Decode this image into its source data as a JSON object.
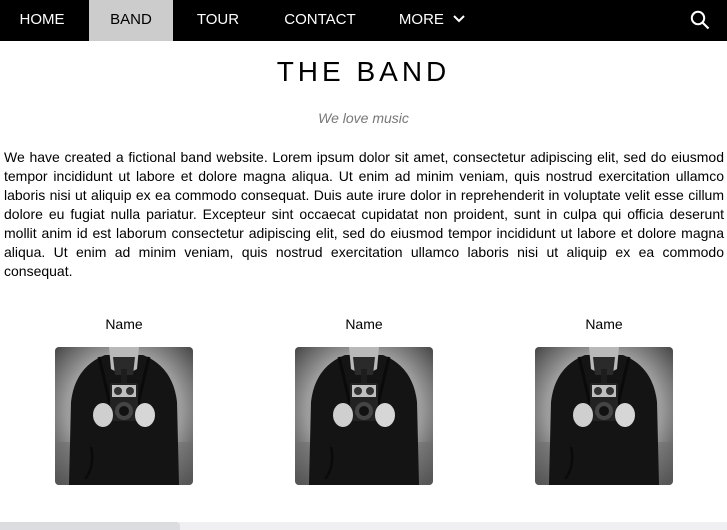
{
  "nav": {
    "items": [
      {
        "label": "HOME"
      },
      {
        "label": "BAND"
      },
      {
        "label": "TOUR"
      },
      {
        "label": "CONTACT"
      },
      {
        "label": "MORE"
      }
    ],
    "active": "BAND",
    "search_icon": "search-icon"
  },
  "band": {
    "title": "THE BAND",
    "tagline": "We love music",
    "description": "We have created a fictional band website. Lorem ipsum dolor sit amet, consectetur adipiscing elit, sed do eiusmod tempor incididunt ut labore et dolore magna aliqua. Ut enim ad minim veniam, quis nostrud exercitation ullamco laboris nisi ut aliquip ex ea commodo consequat. Duis aute irure dolor in reprehenderit in voluptate velit esse cillum dolore eu fugiat nulla pariatur. Excepteur sint occaecat cupidatat non proident, sunt in culpa qui officia deserunt mollit anim id est laborum consectetur adipiscing elit, sed do eiusmod tempor incididunt ut labore et dolore magna aliqua. Ut enim ad minim veniam, quis nostrud exercitation ullamco laboris nisi ut aliquip ex ea commodo consequat."
  },
  "members": [
    {
      "name": "Name"
    },
    {
      "name": "Name"
    },
    {
      "name": "Name"
    }
  ],
  "colors": {
    "navbar": "#000000",
    "active_tab": "#cccccc",
    "tagline": "#777777"
  }
}
